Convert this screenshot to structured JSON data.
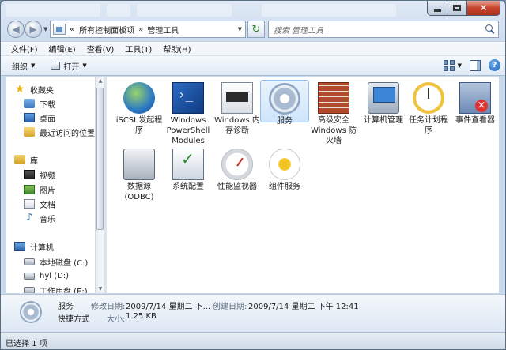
{
  "address": {
    "crumbs": [
      "所有控制面板项",
      "管理工具"
    ],
    "separator": "»",
    "pre": "«"
  },
  "search": {
    "placeholder": "搜索 管理工具"
  },
  "menu": [
    "文件(F)",
    "编辑(E)",
    "查看(V)",
    "工具(T)",
    "帮助(H)"
  ],
  "commands": {
    "organize": "组织",
    "open": "打开"
  },
  "nav": {
    "favorites": "收藏夹",
    "favorites_items": [
      "下载",
      "桌面",
      "最近访问的位置"
    ],
    "libraries": "库",
    "libraries_items": [
      "视频",
      "图片",
      "文档",
      "音乐"
    ],
    "computer": "计算机",
    "computer_items": [
      "本地磁盘 (C:)",
      "hyl (D:)",
      "工作用盘 (E:)"
    ]
  },
  "tiles": [
    {
      "name": "iscsi",
      "label": "iSCSI 发起程序"
    },
    {
      "name": "powershell",
      "label": "Windows PowerShell Modules"
    },
    {
      "name": "memdiag",
      "label": "Windows 内存诊断"
    },
    {
      "name": "services",
      "label": "服务"
    },
    {
      "name": "firewall",
      "label": "高级安全 Windows 防火墙"
    },
    {
      "name": "computer-management",
      "label": "计算机管理"
    },
    {
      "name": "task-scheduler",
      "label": "任务计划程序"
    },
    {
      "name": "event-viewer",
      "label": "事件查看器"
    },
    {
      "name": "odbc",
      "label": "数据源(ODBC)"
    },
    {
      "name": "sysconfig",
      "label": "系统配置"
    },
    {
      "name": "perfmon",
      "label": "性能监视器"
    },
    {
      "name": "component-services",
      "label": "组件服务"
    }
  ],
  "details": {
    "name": "服务",
    "type": "快捷方式",
    "modified_label": "修改日期:",
    "modified_value": "2009/7/14 星期二 下...",
    "created_label": "创建日期:",
    "created_value": "2009/7/14 星期二 下午 12:41",
    "size_label": "大小:",
    "size_value": "1.25 KB"
  },
  "status": {
    "text": "已选择 1 项"
  }
}
